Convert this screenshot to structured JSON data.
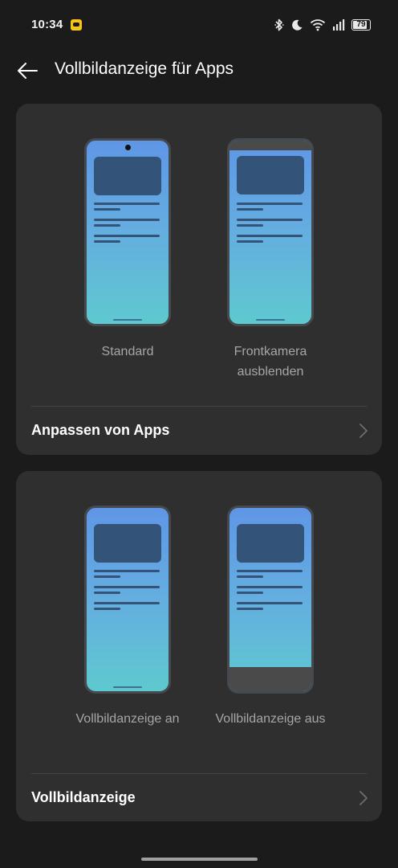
{
  "status_bar": {
    "time": "10:34",
    "battery": "79",
    "icons": [
      "notification-app-icon",
      "bluetooth-icon",
      "moon-icon",
      "wifi-icon",
      "signal-icon",
      "battery-icon"
    ]
  },
  "header": {
    "title": "Vollbildanzeige für Apps",
    "back_icon": "back-arrow-icon"
  },
  "camera_section": {
    "options": [
      {
        "label": "Standard"
      },
      {
        "label": "Frontkamera ausblenden"
      }
    ],
    "nav_label": "Anpassen von Apps"
  },
  "fullscreen_section": {
    "options": [
      {
        "label": "Vollbildanzeige an"
      },
      {
        "label": "Vollbildanzeige aus"
      }
    ],
    "nav_label": "Vollbildanzeige"
  },
  "colors": {
    "background": "#1b1b1b",
    "card": "#2f2f2f",
    "label": "#a6a6a6",
    "preview_gradient_top": "#5f96e6",
    "preview_gradient_bottom": "#5ec9cf"
  }
}
